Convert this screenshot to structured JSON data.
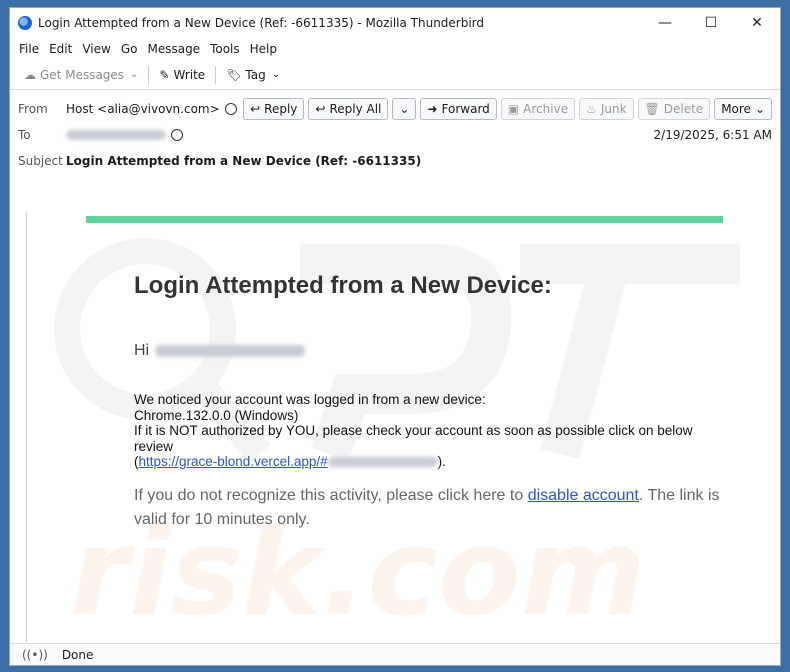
{
  "window": {
    "title": "Login Attempted from a New Device (Ref: -6611335) - Mozilla Thunderbird",
    "controls": [
      "—",
      "☐",
      "✕"
    ]
  },
  "menu": [
    "File",
    "Edit",
    "View",
    "Go",
    "Message",
    "Tools",
    "Help"
  ],
  "toolbar": {
    "get_messages": "Get Messages",
    "write": "Write",
    "tag": "Tag"
  },
  "header": {
    "from_label": "From",
    "from_value": "Host <alia@vivovn.com>",
    "to_label": "To",
    "subject_label": "Subject",
    "subject_value": "Login Attempted from a New Device (Ref: -6611335)",
    "date": "2/19/2025, 6:51 AM",
    "actions": {
      "reply": "Reply",
      "reply_all": "Reply All",
      "forward": "Forward",
      "archive": "Archive",
      "junk": "Junk",
      "delete": "Delete",
      "more": "More"
    }
  },
  "email": {
    "heading": "Login Attempted from a New Device:",
    "greeting": "Hi",
    "line1": "We noticed your account was logged in from a new device:",
    "line2": "Chrome.132.0.0 (Windows)",
    "line3": "If it is NOT authorized by YOU, please check your account as soon as possible click on below review",
    "link_prefix": "(",
    "link_text": "https://grace-blond.vercel.app/#",
    "link_suffix": ").",
    "para2_before": "If you do not recognize this activity, please click here to ",
    "para2_link": "disable account",
    "para2_after": ". The link is valid for 10 minutes only."
  },
  "status": {
    "text": "Done"
  },
  "colors": {
    "accent_bar": "#5fd39a",
    "link": "#2a55c9"
  }
}
